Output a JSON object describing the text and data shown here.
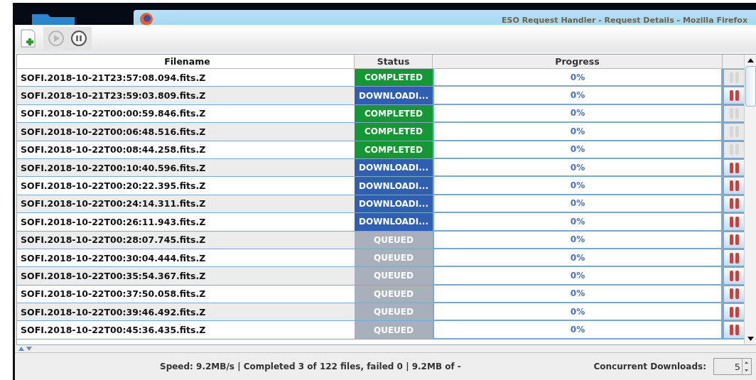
{
  "background_window": {
    "title": "ESO Request Handler - Request Details - Mozilla Firefox"
  },
  "toolbar": {
    "add": {
      "disabled": false
    },
    "start": {
      "disabled": true
    },
    "pause": {
      "disabled": false
    }
  },
  "table": {
    "columns": [
      "Filename",
      "Status",
      "Progress"
    ],
    "rows": [
      {
        "filename": "SOFI.2018-10-21T23:57:08.094.fits.Z",
        "status": "COMPLETED",
        "kind": "completed",
        "progress": "0%",
        "level": 0
      },
      {
        "filename": "SOFI.2018-10-21T23:59:03.809.fits.Z",
        "status": "DOWNLOADI...",
        "kind": "downloading",
        "progress": "0%",
        "level": 0
      },
      {
        "filename": "SOFI.2018-10-22T00:00:59.846.fits.Z",
        "status": "COMPLETED",
        "kind": "completed",
        "progress": "0%",
        "level": 0
      },
      {
        "filename": "SOFI.2018-10-22T00:06:48.516.fits.Z",
        "status": "COMPLETED",
        "kind": "completed",
        "progress": "0%",
        "level": 0
      },
      {
        "filename": "SOFI.2018-10-22T00:08:44.258.fits.Z",
        "status": "COMPLETED",
        "kind": "completed",
        "progress": "0%",
        "level": 0
      },
      {
        "filename": "SOFI.2018-10-22T00:10:40.596.fits.Z",
        "status": "DOWNLOADI...",
        "kind": "downloading",
        "progress": "0%",
        "level": 0
      },
      {
        "filename": "SOFI.2018-10-22T00:20:22.395.fits.Z",
        "status": "DOWNLOADI...",
        "kind": "downloading",
        "progress": "0%",
        "level": 0
      },
      {
        "filename": "SOFI.2018-10-22T00:24:14.311.fits.Z",
        "status": "DOWNLOADI...",
        "kind": "downloading",
        "progress": "0%",
        "level": 0
      },
      {
        "filename": "SOFI.2018-10-22T00:26:11.943.fits.Z",
        "status": "DOWNLOADI...",
        "kind": "downloading",
        "progress": "0%",
        "level": 0
      },
      {
        "filename": "SOFI.2018-10-22T00:28:07.745.fits.Z",
        "status": "QUEUED",
        "kind": "queued",
        "progress": "0%",
        "level": 0
      },
      {
        "filename": "SOFI.2018-10-22T00:30:04.444.fits.Z",
        "status": "QUEUED",
        "kind": "queued",
        "progress": "0%",
        "level": 0
      },
      {
        "filename": "SOFI.2018-10-22T00:35:54.367.fits.Z",
        "status": "QUEUED",
        "kind": "queued",
        "progress": "0%",
        "level": 0
      },
      {
        "filename": "SOFI.2018-10-22T00:37:50.058.fits.Z",
        "status": "QUEUED",
        "kind": "queued",
        "progress": "0%",
        "level": 0
      },
      {
        "filename": "SOFI.2018-10-22T00:39:46.492.fits.Z",
        "status": "QUEUED",
        "kind": "queued",
        "progress": "0%",
        "level": 0
      },
      {
        "filename": "SOFI.2018-10-22T00:45:36.435.fits.Z",
        "status": "QUEUED",
        "kind": "queued",
        "progress": "0%",
        "level": 0
      }
    ]
  },
  "status_bar": {
    "summary": "Speed: 9.2MB/s | Completed 3 of 122 files, failed 0 | 9.2MB of -",
    "concurrent_label": "Concurrent Downloads:",
    "concurrent_value": "5"
  }
}
